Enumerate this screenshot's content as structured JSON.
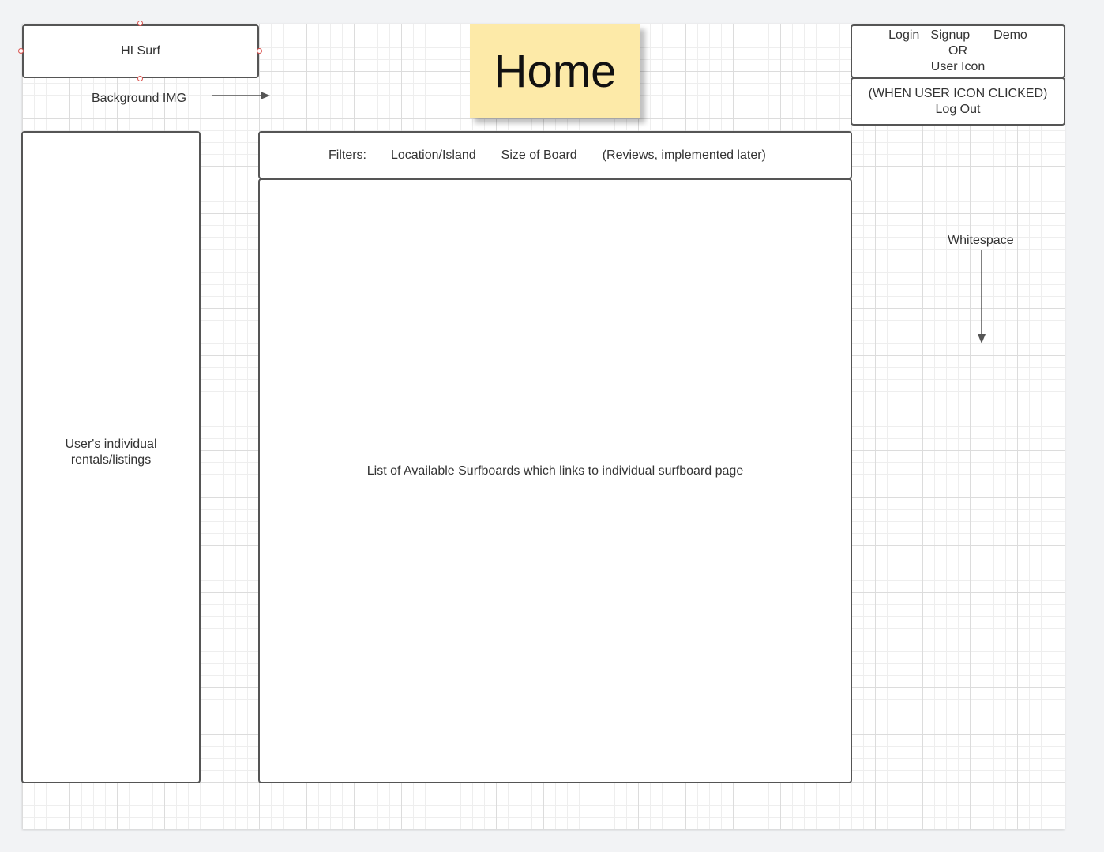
{
  "logo_box": {
    "text": "HI Surf"
  },
  "background_note": {
    "text": "Background IMG"
  },
  "sticky_note": {
    "text": "Home"
  },
  "auth_box": {
    "login": "Login",
    "signup": "Signup",
    "demo": "Demo",
    "or": "OR",
    "user_icon": "User Icon"
  },
  "logout_box": {
    "line1": "(WHEN USER ICON CLICKED)",
    "line2": "Log Out"
  },
  "filters_bar": {
    "label": "Filters:",
    "items": [
      "Location/Island",
      "Size of Board",
      "(Reviews, implemented later)"
    ]
  },
  "main_list": {
    "text": "List of Available Surfboards which links to individual surfboard page"
  },
  "sidebar": {
    "line1": "User's individual",
    "line2": "rentals/listings"
  },
  "whitespace_note": {
    "text": "Whitespace"
  },
  "colors": {
    "canvas": "#ffffff",
    "grid": "#dcdcdc",
    "border": "#555555",
    "sticky": "#fdeaa8",
    "selection_handle": "#d9534f"
  }
}
